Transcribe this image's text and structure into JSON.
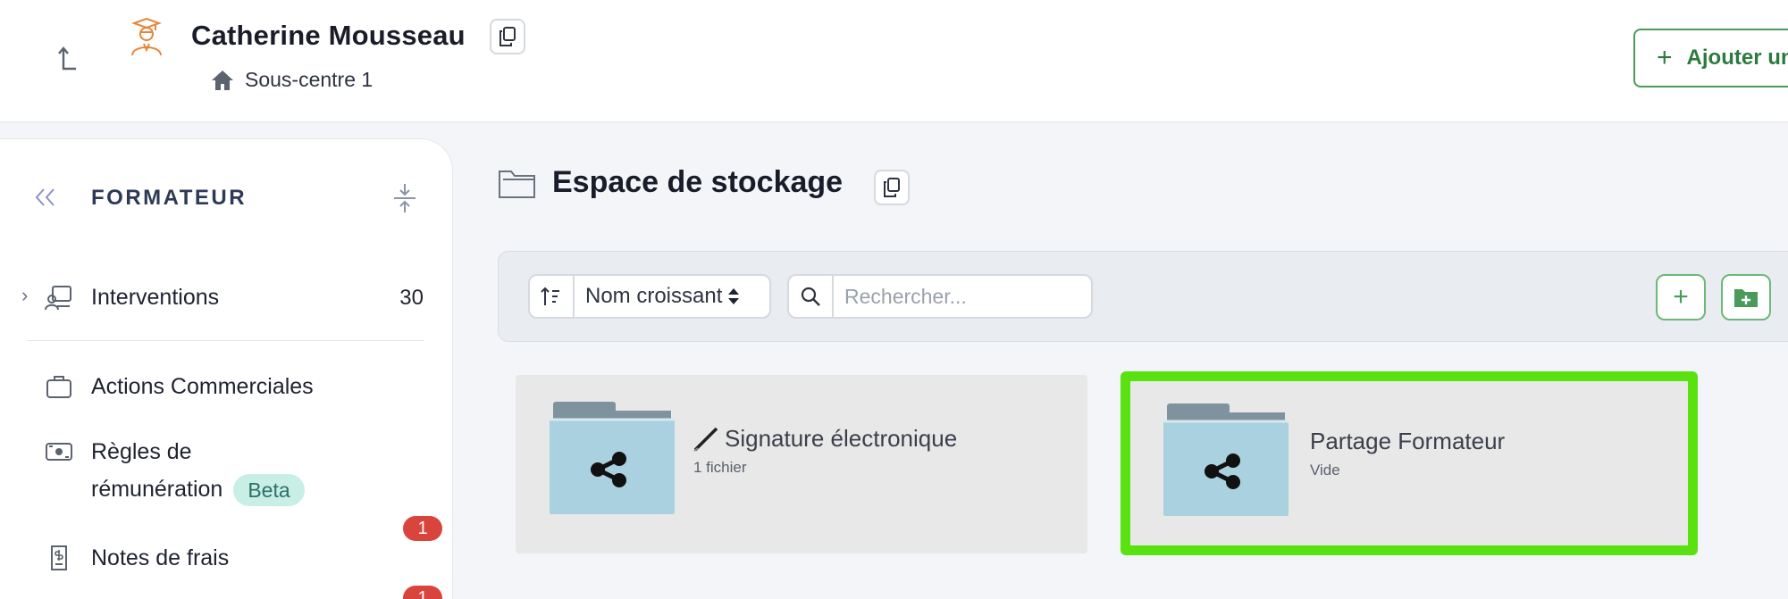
{
  "header": {
    "title": "Catherine Mousseau",
    "breadcrumb": "Sous-centre 1",
    "add_button_label": "Ajouter un"
  },
  "sidebar": {
    "title": "FORMATEUR",
    "items": [
      {
        "label": "Interventions",
        "count": "30",
        "icon": "interventions-icon"
      },
      {
        "label": "Actions Commerciales",
        "icon": "briefcase-icon"
      },
      {
        "label_line1": "Règles de",
        "label_line2": "rémunération",
        "badge": "Beta",
        "icon": "money-icon"
      },
      {
        "label": "Notes de frais",
        "icon": "receipt-icon",
        "notification": "1"
      },
      {
        "notification": "1"
      }
    ]
  },
  "main": {
    "title": "Espace de stockage",
    "toolbar": {
      "sort_label": "Nom croissant",
      "search_placeholder": "Rechercher..."
    },
    "folders": [
      {
        "name": "Signature électronique",
        "subtitle": "1 fichier",
        "selected": false
      },
      {
        "name": "Partage Formateur",
        "subtitle": "Vide",
        "selected": true
      }
    ]
  },
  "colors": {
    "accent_green": "#4a9a5a",
    "highlight_green": "#59e20f",
    "badge_teal": "#c7efe6",
    "notification_red": "#d9453d",
    "folder_blue": "#a9d1e0",
    "user_icon_orange": "#e8853a"
  }
}
